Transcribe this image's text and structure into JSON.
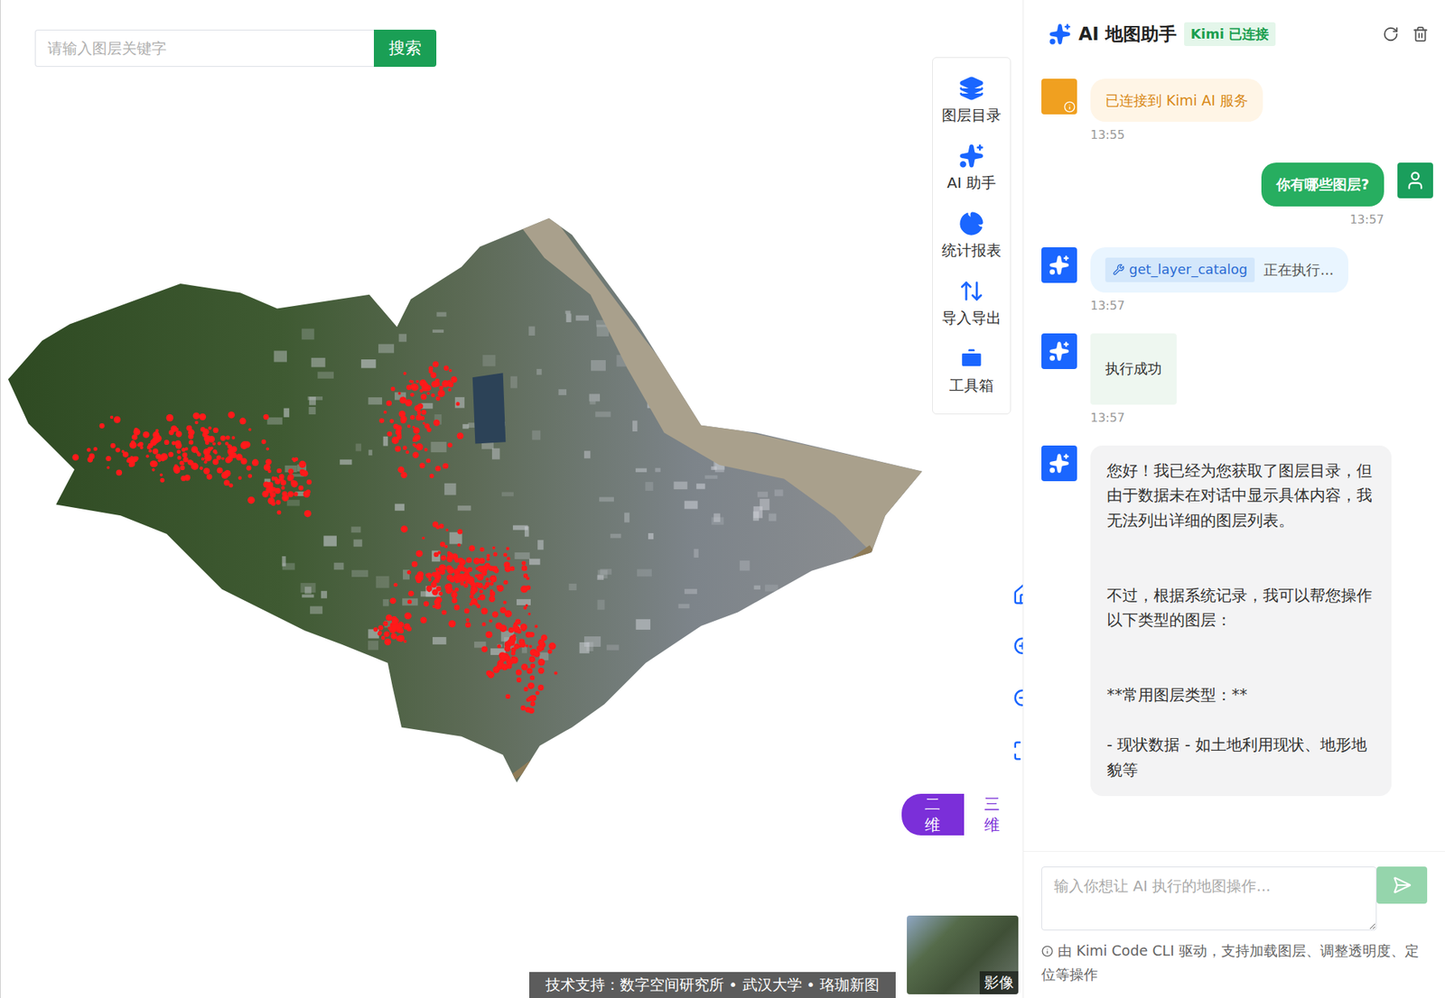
{
  "search": {
    "placeholder": "请输入图层关键字",
    "button": "搜索"
  },
  "toolbar": {
    "items": [
      {
        "label": "图层目录",
        "icon": "layers"
      },
      {
        "label": "AI 助手",
        "icon": "sparkles"
      },
      {
        "label": "统计报表",
        "icon": "pie"
      },
      {
        "label": "导入导出",
        "icon": "transfer"
      },
      {
        "label": "工具箱",
        "icon": "toolbox"
      }
    ]
  },
  "view_toggle": [
    {
      "label": "二维",
      "selected": true
    },
    {
      "label": "三维",
      "selected": false
    }
  ],
  "basemap": {
    "label": "影像"
  },
  "credit": "技术支持：数字空间研究所 • 武汉大学 • 珞珈新图",
  "chat": {
    "title": "AI 地图助手",
    "status": "Kimi 已连接",
    "messages": [
      {
        "role": "system",
        "kind": "notice",
        "text": "已连接到 Kimi AI 服务",
        "time": "13:55"
      },
      {
        "role": "user",
        "kind": "text",
        "text": "你有哪些图层?",
        "time": "13:57"
      },
      {
        "role": "assistant",
        "kind": "tool",
        "tool": "get_layer_catalog",
        "status": "正在执行...",
        "time": "13:57"
      },
      {
        "role": "assistant",
        "kind": "success",
        "text": "执行成功",
        "time": "13:57"
      },
      {
        "role": "assistant",
        "kind": "long",
        "paragraphs": [
          "您好！我已经为您获取了图层目录，但由于数据未在对话中显示具体内容，我无法列出详细的图层列表。",
          "",
          "",
          "不过，根据系统记录，我可以帮您操作以下类型的图层：",
          "",
          "",
          "**常用图层类型：**",
          "",
          "- 现状数据 - 如土地利用现状、地形地貌等"
        ]
      }
    ],
    "input": {
      "placeholder": "输入你想让 AI 执行的地图操作..."
    },
    "footer": "由 Kimi Code CLI 驱动，支持加载图层、调整透明度、定位等操作"
  }
}
